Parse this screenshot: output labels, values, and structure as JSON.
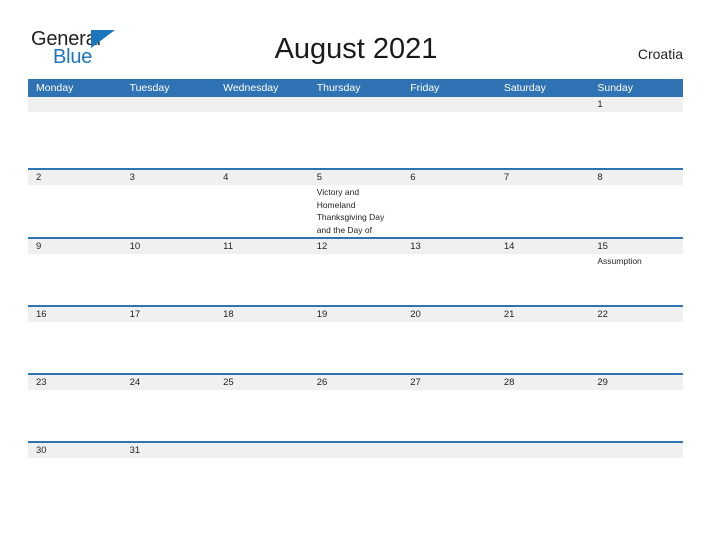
{
  "brand": {
    "name_part1": "General",
    "name_part2": "Blue",
    "triangle_icon": "blue-triangle-icon",
    "color_dark": "#231f20",
    "color_blue": "#1b76bc"
  },
  "header": {
    "title": "August 2021",
    "country": "Croatia"
  },
  "theme": {
    "header_blue": "#2f73b5",
    "row_band_gray": "#f0f0f0",
    "body_white": "#ffffff",
    "text_dark": "#231f20"
  },
  "calendar": {
    "month": "August",
    "year": "2021",
    "weekdays": [
      "Monday",
      "Tuesday",
      "Wednesday",
      "Thursday",
      "Friday",
      "Saturday",
      "Sunday"
    ],
    "weeks": [
      {
        "days": [
          {
            "number": "",
            "event": ""
          },
          {
            "number": "",
            "event": ""
          },
          {
            "number": "",
            "event": ""
          },
          {
            "number": "",
            "event": ""
          },
          {
            "number": "",
            "event": ""
          },
          {
            "number": "",
            "event": ""
          },
          {
            "number": "1",
            "event": ""
          }
        ]
      },
      {
        "days": [
          {
            "number": "2",
            "event": ""
          },
          {
            "number": "3",
            "event": ""
          },
          {
            "number": "4",
            "event": ""
          },
          {
            "number": "5",
            "event": "Victory and Homeland Thanksgiving Day and the Day of"
          },
          {
            "number": "6",
            "event": ""
          },
          {
            "number": "7",
            "event": ""
          },
          {
            "number": "8",
            "event": ""
          }
        ]
      },
      {
        "days": [
          {
            "number": "9",
            "event": ""
          },
          {
            "number": "10",
            "event": ""
          },
          {
            "number": "11",
            "event": ""
          },
          {
            "number": "12",
            "event": ""
          },
          {
            "number": "13",
            "event": ""
          },
          {
            "number": "14",
            "event": ""
          },
          {
            "number": "15",
            "event": "Assumption"
          }
        ]
      },
      {
        "days": [
          {
            "number": "16",
            "event": ""
          },
          {
            "number": "17",
            "event": ""
          },
          {
            "number": "18",
            "event": ""
          },
          {
            "number": "19",
            "event": ""
          },
          {
            "number": "20",
            "event": ""
          },
          {
            "number": "21",
            "event": ""
          },
          {
            "number": "22",
            "event": ""
          }
        ]
      },
      {
        "days": [
          {
            "number": "23",
            "event": ""
          },
          {
            "number": "24",
            "event": ""
          },
          {
            "number": "25",
            "event": ""
          },
          {
            "number": "26",
            "event": ""
          },
          {
            "number": "27",
            "event": ""
          },
          {
            "number": "28",
            "event": ""
          },
          {
            "number": "29",
            "event": ""
          }
        ]
      },
      {
        "days": [
          {
            "number": "30",
            "event": ""
          },
          {
            "number": "31",
            "event": ""
          },
          {
            "number": "",
            "event": ""
          },
          {
            "number": "",
            "event": ""
          },
          {
            "number": "",
            "event": ""
          },
          {
            "number": "",
            "event": ""
          },
          {
            "number": "",
            "event": ""
          }
        ]
      }
    ]
  }
}
